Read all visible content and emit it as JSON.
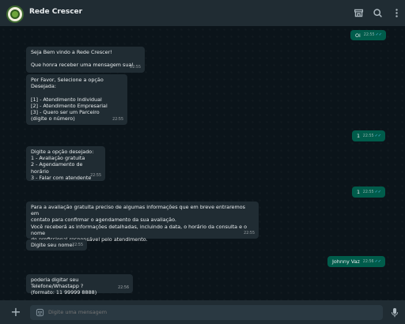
{
  "header": {
    "title": "Rede Crescer",
    "icons": [
      "store-icon",
      "search-icon",
      "more-icon"
    ]
  },
  "messages": [
    {
      "dir": "out",
      "text": "Oi",
      "time": "22:55",
      "read": true
    },
    {
      "dir": "in",
      "text": "Seja Bem vindo a Rede Crescer!\n\nQue honra receber uma mensagem sua!",
      "time": "22:55"
    },
    {
      "dir": "in",
      "text": "Por Favor, Selecione a opção Desejada:\n\n[1] - Atendimento Individual\n[2] - Atendimento Empresarial\n[3] - Quero ser um Parceiro\n(digite o número)",
      "time": "22:55"
    },
    {
      "dir": "out",
      "text": "1",
      "time": "22:55",
      "read": true
    },
    {
      "dir": "in",
      "text": "Digite a opção desejado:\n1 - Avaliação gratuita\n2 - Agendamento de horário\n3 - Falar com atendente",
      "time": "22:55"
    },
    {
      "dir": "out",
      "text": "1",
      "time": "22:55",
      "read": true
    },
    {
      "dir": "in",
      "text": "Para a avaliação gratuita preciso de algumas informações que em breve entraremos em\ncontato para confirmar o agendamento da sua avaliação.\nVocê receberá as informações detalhadas, incluindo a data, o horário da consulta e o nome\ndo profissional responsável pelo atendimento.",
      "time": "22:55"
    },
    {
      "dir": "in",
      "text": "Digite seu nome:",
      "time": "22:55"
    },
    {
      "dir": "out",
      "text": "Johnny Vaz",
      "time": "22:56",
      "read": true
    },
    {
      "dir": "in",
      "text": "poderia digitar seu Telefone/Whastapp ?\n(formato: 11 99999 8888)",
      "time": "22:56"
    }
  ],
  "composer": {
    "placeholder": "Digite uma mensagem",
    "icons": [
      "plus-icon",
      "emoji-icon",
      "mic-icon"
    ]
  },
  "colors": {
    "header_bg": "#202c33",
    "chat_bg": "#0b141a",
    "incoming_bubble": "#202c33",
    "outgoing_bubble": "#005c4b",
    "read_check": "#53bdeb"
  }
}
